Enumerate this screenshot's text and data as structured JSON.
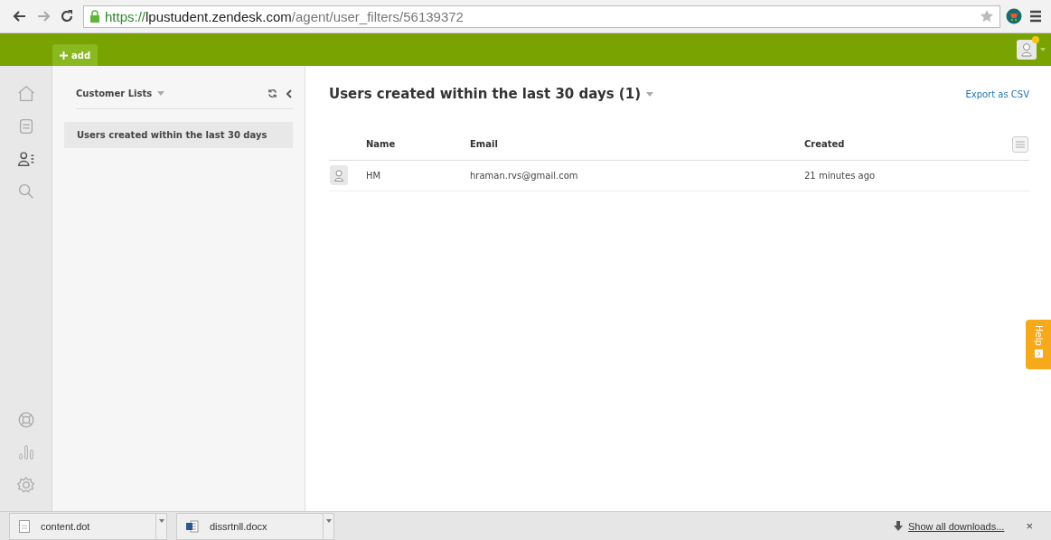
{
  "browser": {
    "url": {
      "scheme": "https://",
      "host": "lpustudent.zendesk.com",
      "path": "/agent/user_filters/56139372"
    }
  },
  "topbar": {
    "add_label": "add",
    "notification": true
  },
  "nav": {
    "top": [
      {
        "kind": "home",
        "selected": false
      },
      {
        "kind": "tickets",
        "selected": false
      },
      {
        "kind": "users",
        "selected": true
      },
      {
        "kind": "search",
        "selected": false
      }
    ],
    "bottom": [
      {
        "kind": "help",
        "selected": false
      },
      {
        "kind": "reports",
        "selected": false
      },
      {
        "kind": "settings",
        "selected": false
      }
    ]
  },
  "lists_panel": {
    "title": "Customer Lists",
    "items": [
      {
        "label": "Users created within the last 30 days",
        "selected": true
      }
    ]
  },
  "view": {
    "title": "Users created within the last 30 days (1)",
    "export": "Export as CSV",
    "table": {
      "columns": [
        "Name",
        "Email",
        "Created"
      ],
      "rows": [
        {
          "name": "HM",
          "email": "hraman.rvs@gmail.com",
          "created": "21 minutes ago"
        }
      ]
    }
  },
  "help_tab": {
    "label": "Help"
  },
  "downloads": {
    "items": [
      {
        "name": "content.dot",
        "kind": "file"
      },
      {
        "name": "dissrtnll.docx",
        "kind": "word"
      }
    ],
    "show_all": "Show all downloads...",
    "close": "×"
  }
}
